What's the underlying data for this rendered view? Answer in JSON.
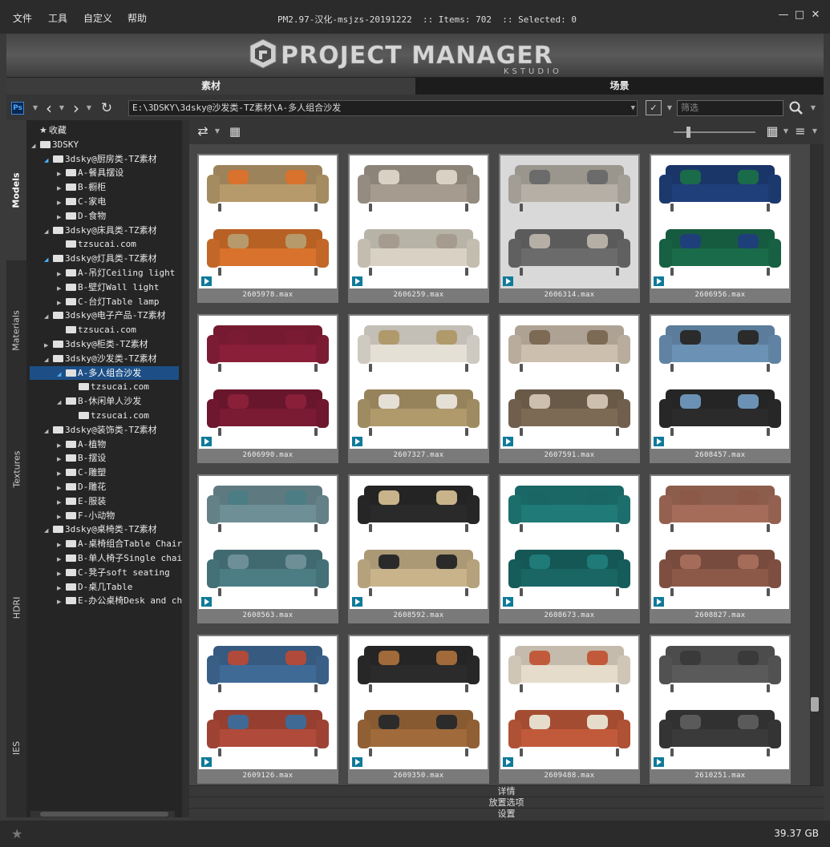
{
  "menu": [
    "文件",
    "工具",
    "自定义",
    "帮助"
  ],
  "window_title": "PM2.97-汉化-msjzs-20191222  :: Items: 702  :: Selected: 0",
  "banner": {
    "title": "PROJECT MANAGER",
    "subtitle": "KSTUDIO"
  },
  "tabs": {
    "assets": "素材",
    "scene": "场景"
  },
  "address": {
    "path": "E:\\3DSKY\\3dsky@沙发类-TZ素材\\A-多人组合沙发",
    "filter_placeholder": "筛选"
  },
  "side_tabs": [
    "Models",
    "Materials",
    "Textures",
    "HDRI",
    "IES"
  ],
  "tree": [
    {
      "label": "收藏",
      "depth": 0,
      "icon": "star",
      "arrow": "none"
    },
    {
      "label": "3DSKY",
      "depth": 0,
      "arrow": "open-dark"
    },
    {
      "label": "3dsky@厨房类-TZ素材",
      "depth": 1,
      "arrow": "open"
    },
    {
      "label": "A-餐具摆设",
      "depth": 2,
      "arrow": "closed"
    },
    {
      "label": "B-橱柜",
      "depth": 2,
      "arrow": "closed"
    },
    {
      "label": "C-家电",
      "depth": 2,
      "arrow": "closed"
    },
    {
      "label": "D-食物",
      "depth": 2,
      "arrow": "closed"
    },
    {
      "label": "3dsky@床具类-TZ素材",
      "depth": 1,
      "arrow": "open-dark"
    },
    {
      "label": "tzsucai.com",
      "depth": 2,
      "arrow": "none"
    },
    {
      "label": "3dsky@灯具类-TZ素材",
      "depth": 1,
      "arrow": "open"
    },
    {
      "label": "A-吊灯Ceiling light",
      "depth": 2,
      "arrow": "closed"
    },
    {
      "label": "B-壁灯Wall light",
      "depth": 2,
      "arrow": "closed"
    },
    {
      "label": "C-台灯Table lamp",
      "depth": 2,
      "arrow": "closed"
    },
    {
      "label": "3dsky@电子产品-TZ素材",
      "depth": 1,
      "arrow": "open-dark"
    },
    {
      "label": "tzsucai.com",
      "depth": 2,
      "arrow": "none"
    },
    {
      "label": "3dsky@柜类-TZ素材",
      "depth": 1,
      "arrow": "closed"
    },
    {
      "label": "3dsky@沙发类-TZ素材",
      "depth": 1,
      "arrow": "open-dark"
    },
    {
      "label": "A-多人组合沙发",
      "depth": 2,
      "arrow": "open",
      "selected": true
    },
    {
      "label": "tzsucai.com",
      "depth": 3,
      "arrow": "none"
    },
    {
      "label": "B-休闲单人沙发",
      "depth": 2,
      "arrow": "open-dark"
    },
    {
      "label": "tzsucai.com",
      "depth": 3,
      "arrow": "none"
    },
    {
      "label": "3dsky@装饰类-TZ素材",
      "depth": 1,
      "arrow": "open-dark"
    },
    {
      "label": "A-植物",
      "depth": 2,
      "arrow": "closed"
    },
    {
      "label": "B-摆设",
      "depth": 2,
      "arrow": "closed"
    },
    {
      "label": "C-雕塑",
      "depth": 2,
      "arrow": "closed"
    },
    {
      "label": "D-雕花",
      "depth": 2,
      "arrow": "closed"
    },
    {
      "label": "E-服装",
      "depth": 2,
      "arrow": "closed"
    },
    {
      "label": "F-小动物",
      "depth": 2,
      "arrow": "closed"
    },
    {
      "label": "3dsky@桌椅类-TZ素材",
      "depth": 1,
      "arrow": "open-dark"
    },
    {
      "label": "A-桌椅组合Table Chair",
      "depth": 2,
      "arrow": "closed"
    },
    {
      "label": "B-单人椅子Single chair",
      "depth": 2,
      "arrow": "closed"
    },
    {
      "label": "C-凳子soft seating",
      "depth": 2,
      "arrow": "closed"
    },
    {
      "label": "D-桌几Table",
      "depth": 2,
      "arrow": "closed"
    },
    {
      "label": "E-办公桌椅Desk and chair",
      "depth": 2,
      "arrow": "closed"
    }
  ],
  "items": [
    {
      "name": "2605978.max",
      "color": "#b79a6b",
      "accent": "#d8722c",
      "bg": "#ffffff"
    },
    {
      "name": "2606259.max",
      "color": "#a59b8e",
      "accent": "#d9d2c4",
      "bg": "#ffffff"
    },
    {
      "name": "2606314.max",
      "color": "#b5afa6",
      "accent": "#6b6b6b",
      "bg": "#d9d9d9"
    },
    {
      "name": "2606956.max",
      "color": "#1f3f7a",
      "accent": "#1a6b4a",
      "bg": "#ffffff"
    },
    {
      "name": "2606990.max",
      "color": "#8a1f3a",
      "accent": "#7a1a33",
      "bg": "#ffffff"
    },
    {
      "name": "2607327.max",
      "color": "#e5e0d6",
      "accent": "#b09a6c",
      "bg": "#ffffff"
    },
    {
      "name": "2607591.max",
      "color": "#cdbfae",
      "accent": "#7c6a55",
      "bg": "#ffffff"
    },
    {
      "name": "2608457.max",
      "color": "#6b92b5",
      "accent": "#2b2b2b",
      "bg": "#ffffff"
    },
    {
      "name": "2608563.max",
      "color": "#6e8f96",
      "accent": "#4c7d84",
      "bg": "#ffffff"
    },
    {
      "name": "2608592.max",
      "color": "#2a2a2a",
      "accent": "#c9b38a",
      "bg": "#ffffff"
    },
    {
      "name": "2608673.max",
      "color": "#1f7a78",
      "accent": "#196664",
      "bg": "#ffffff"
    },
    {
      "name": "2608827.max",
      "color": "#a56c5a",
      "accent": "#8c5848",
      "bg": "#ffffff"
    },
    {
      "name": "2609126.max",
      "color": "#3f6a96",
      "accent": "#b04a3a",
      "bg": "#ffffff"
    },
    {
      "name": "2609350.max",
      "color": "#2b2b2b",
      "accent": "#a06a3a",
      "bg": "#ffffff"
    },
    {
      "name": "2609488.max",
      "color": "#e6dccb",
      "accent": "#c15a3a",
      "bg": "#ffffff"
    },
    {
      "name": "2610251.max",
      "color": "#5a5a5a",
      "accent": "#3a3a3a",
      "bg": "#ffffff"
    }
  ],
  "collapsibles": [
    "详情",
    "放置选项",
    "设置"
  ],
  "status": {
    "disk": "39.37 GB"
  }
}
